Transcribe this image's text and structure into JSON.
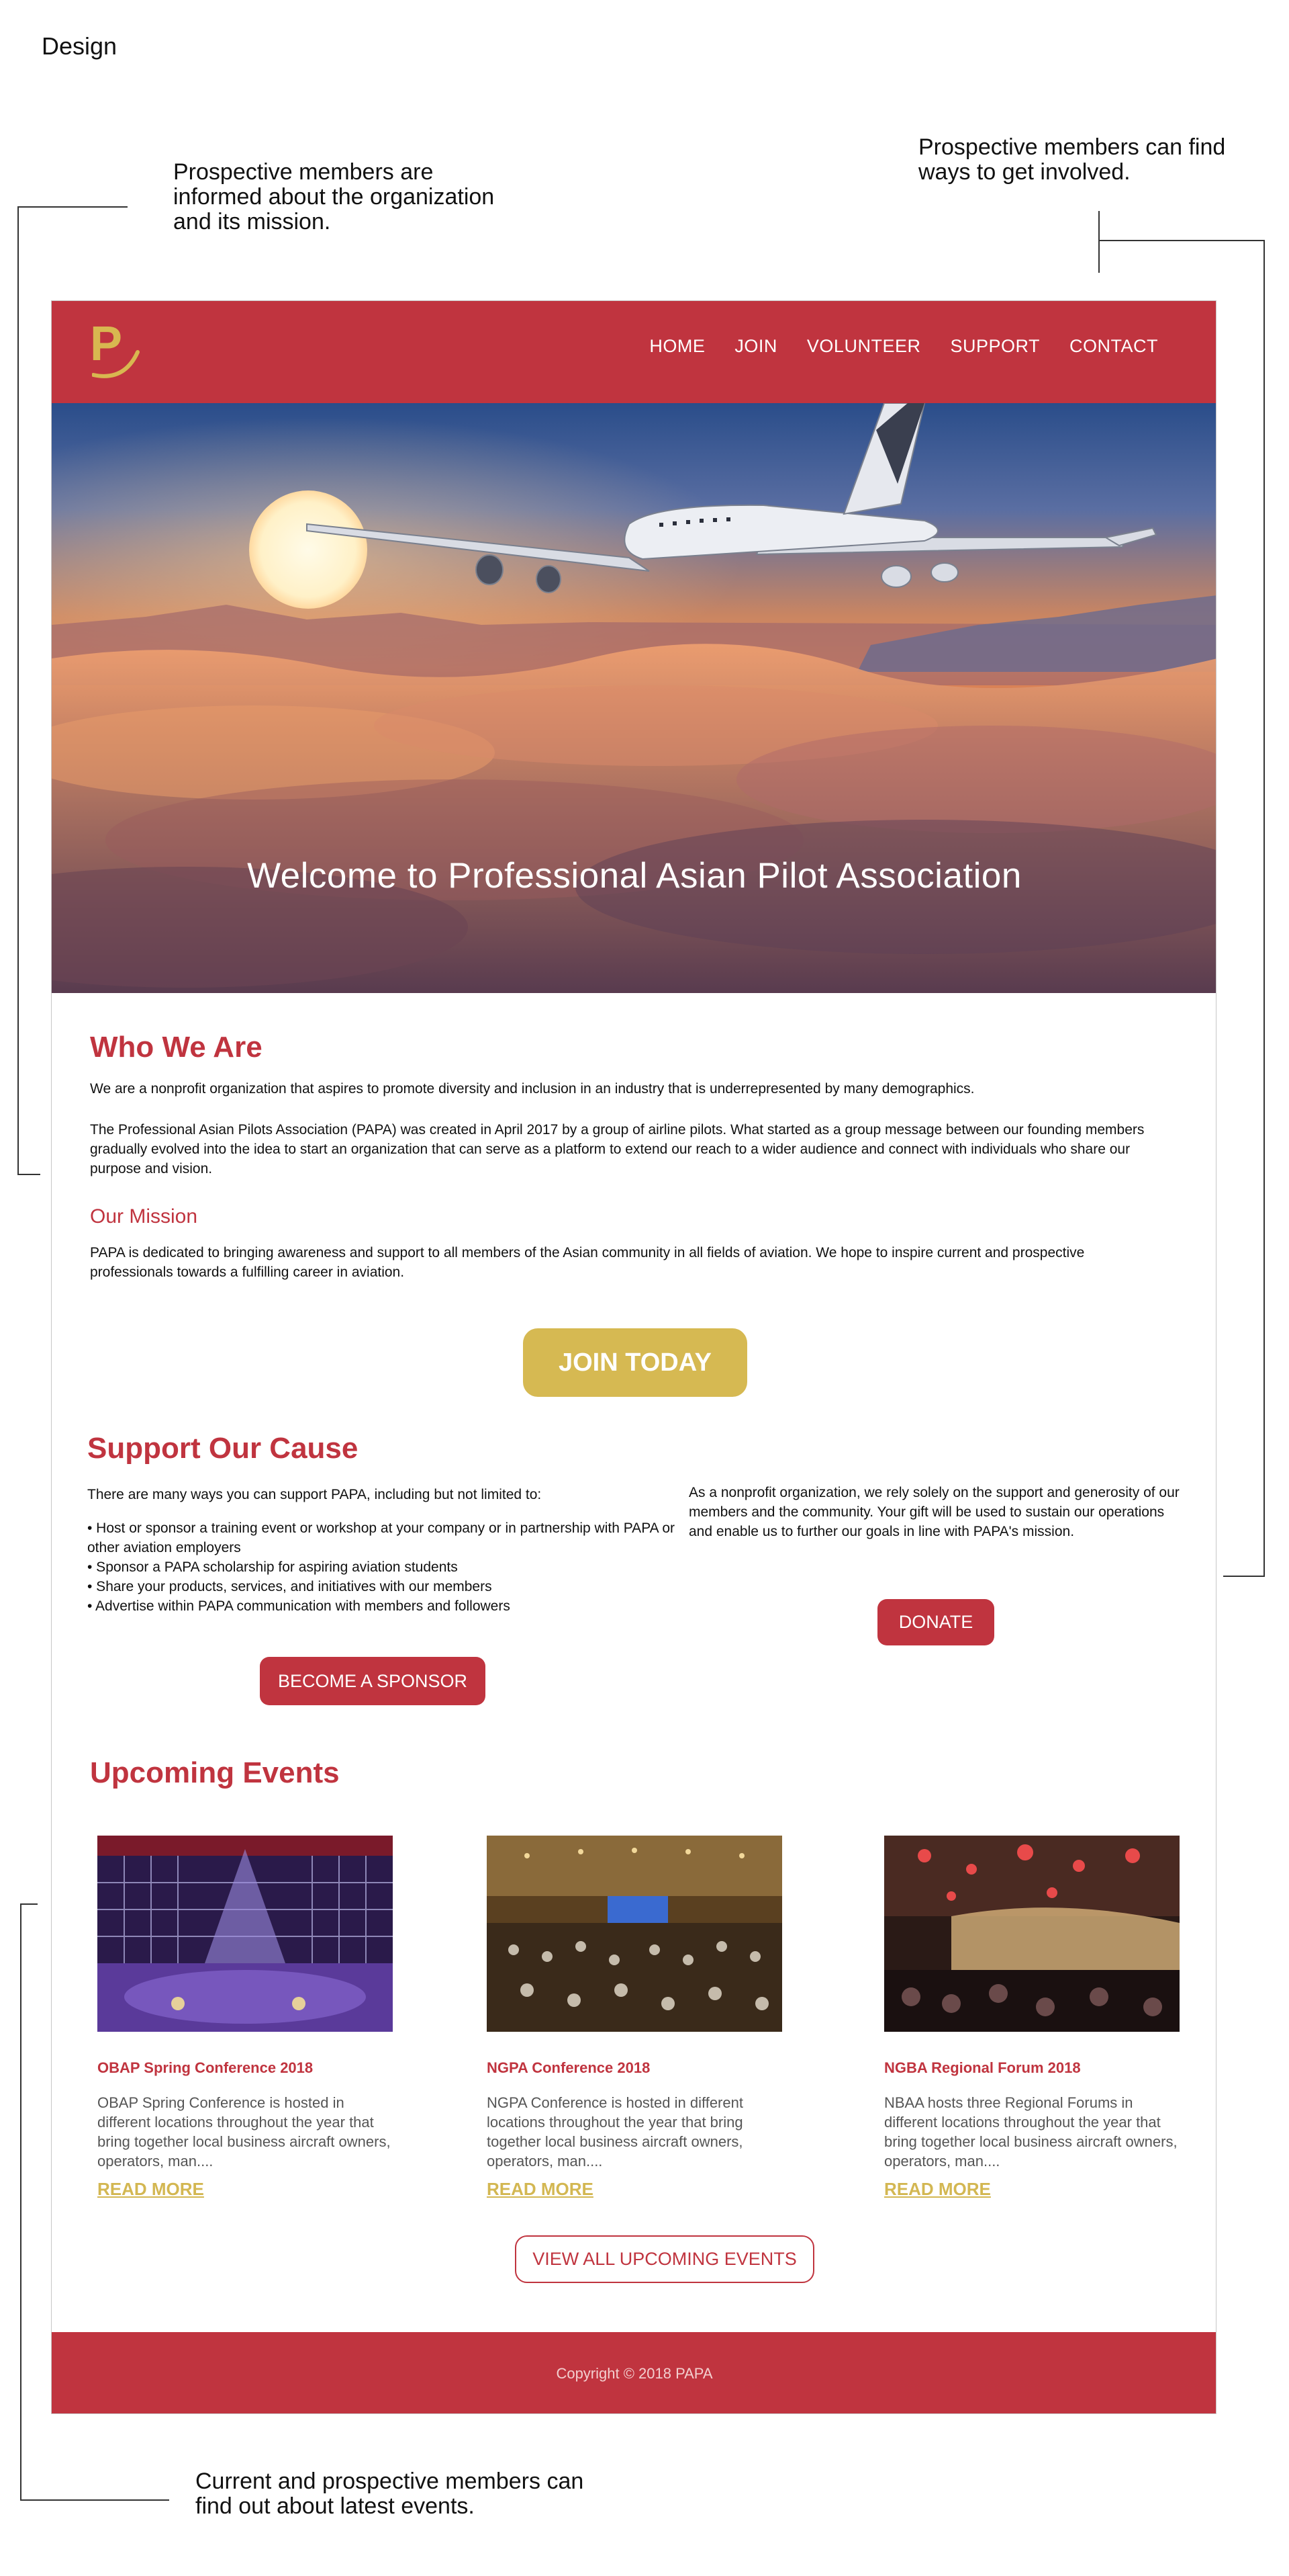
{
  "page": {
    "design_label": "Design"
  },
  "annotations": {
    "note_about": "Prospective members are informed about the organization and its mission.",
    "note_involved": "Prospective members can find ways to get involved.",
    "note_events": "Current and prospective members can find out about latest events."
  },
  "header": {
    "logo_letter": "P",
    "nav": [
      "HOME",
      "JOIN",
      "VOLUNTEER",
      "SUPPORT",
      "CONTACT"
    ]
  },
  "hero": {
    "title": "Welcome to Professional Asian Pilot Association"
  },
  "who": {
    "title": "Who We Are",
    "p1": "We are a nonprofit organization that aspires to promote diversity and inclusion in an industry that is underrepresented by many demographics.",
    "p2": "The Professional Asian Pilots Association (PAPA) was created in April 2017 by a group of airline pilots. What started as a group message between our founding members gradually evolved into the idea to start an organization that can serve as a platform to extend our reach to a wider audience and connect with individuals who share our purpose and vision.",
    "mission_title": "Our Mission",
    "mission_text": "PAPA is dedicated to bringing awareness and support to all members of the Asian community in all fields of aviation. We hope to inspire current and prospective professionals towards a fulfilling career in aviation.",
    "join_button": "JOIN TODAY"
  },
  "support": {
    "title": "Support Our Cause",
    "intro": "There are many ways you can support PAPA, including but not limited to:",
    "items": [
      "• Host or sponsor a training event or workshop at your company or in partnership with PAPA or other aviation employers",
      "• Sponsor a PAPA scholarship for aspiring aviation students",
      "• Share your products, services, and initiatives with our members",
      "• Advertise within PAPA communication with members and followers"
    ],
    "right_text": "As a nonprofit organization, we rely solely on the support and generosity of our members and the community. Your gift will be used to sustain our operations and enable us to further our goals in line with PAPA's mission.",
    "donate_button": "DONATE",
    "sponsor_button": "BECOME A SPONSOR"
  },
  "events": {
    "title": "Upcoming Events",
    "items": [
      {
        "name": "OBAP Spring Conference 2018",
        "desc": "OBAP Spring Conference is hosted in different locations throughout the year that bring together local business aircraft owners, operators, man....",
        "more": "READ MORE"
      },
      {
        "name": "NGPA Conference 2018",
        "desc": "NGPA Conference is hosted in different locations throughout the year that bring together local business aircraft owners, operators, man....",
        "more": "READ MORE"
      },
      {
        "name": "NGBA Regional Forum 2018",
        "desc": "NBAA hosts three Regional Forums in different locations throughout the year that bring together local business aircraft owners, operators, man....",
        "more": "READ MORE"
      }
    ],
    "view_all_button": "VIEW ALL UPCOMING EVENTS"
  },
  "footer": {
    "copyright": "Copyright © 2018 PAPA"
  },
  "colors": {
    "brand_red": "#c0343f",
    "brand_gold": "#d6b952"
  }
}
